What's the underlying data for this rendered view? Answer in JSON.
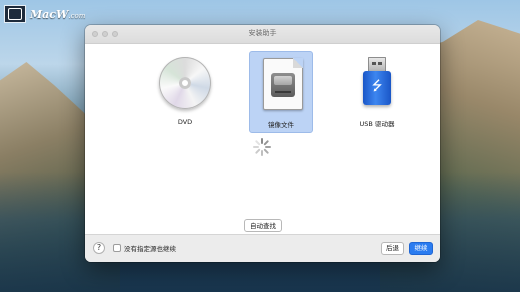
{
  "watermark": {
    "logo_text": "MacW",
    "logo_suffix": ".com"
  },
  "window": {
    "title": "安装助手",
    "options": [
      {
        "label": "DVD",
        "icon": "dvd-disc-icon",
        "selected": false
      },
      {
        "label": "镜像文件",
        "icon": "disk-image-file-icon",
        "selected": true
      },
      {
        "label": "USB 驱动器",
        "icon": "usb-drive-icon",
        "selected": false
      }
    ],
    "find_button": "自动查找",
    "help_label": "?",
    "checkbox_label": "没有指定源也继续",
    "back_button": "后退",
    "continue_button": "继续",
    "colors": {
      "selection": "#bcd3f5",
      "primary_button": "#2b7cf0"
    }
  }
}
